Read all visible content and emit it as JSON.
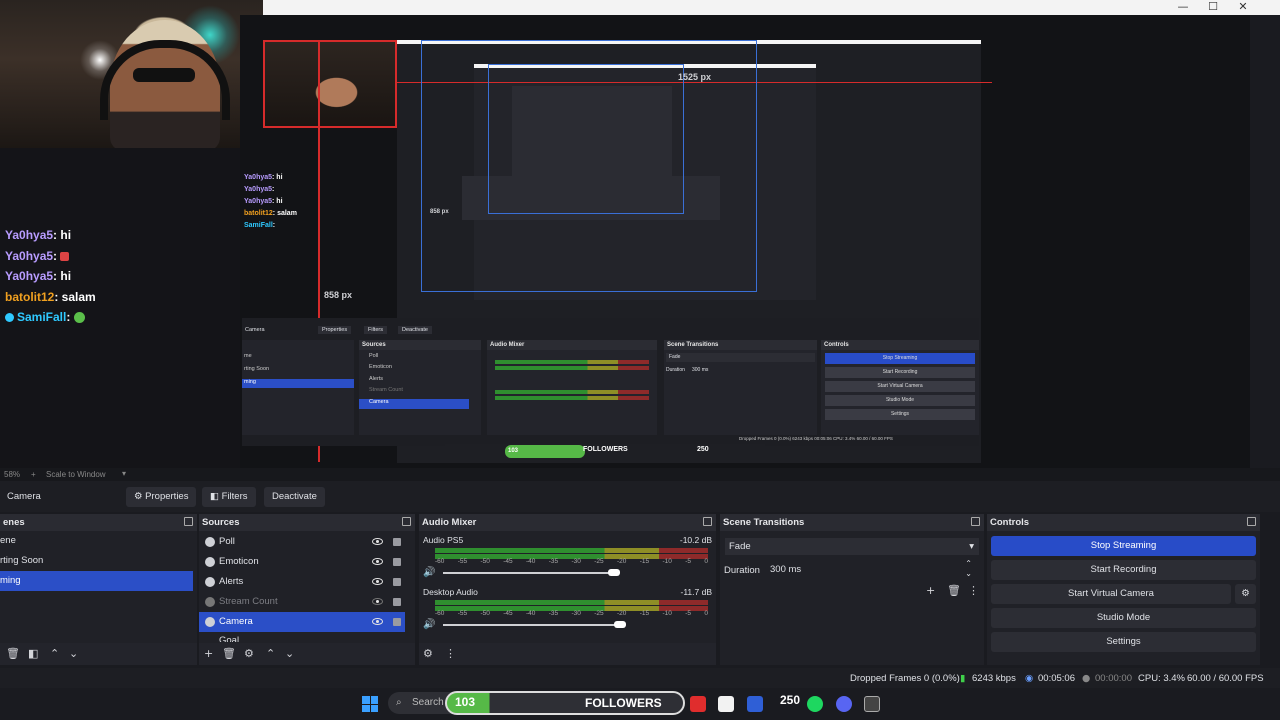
{
  "window": {
    "minimize": "—",
    "maximize": "☐",
    "close": "✕"
  },
  "chat": [
    {
      "user": "Ya0hya5",
      "msg": ": hi",
      "color": "#b89cff"
    },
    {
      "user": "Ya0hya5",
      "msg": ": ",
      "color": "#b89cff"
    },
    {
      "user": "Ya0hya5",
      "msg": ": hi",
      "color": "#b89cff"
    },
    {
      "user": "batolit12",
      "msg": ": salam",
      "color": "#f0a020"
    },
    {
      "user": "SamiFall",
      "msg": ": ",
      "color": "#2fc9ff"
    }
  ],
  "preview": {
    "width_label": "1525 px",
    "height_label": "858 px",
    "height_label_small": "858 px"
  },
  "mini": {
    "toolbar": {
      "camera": "Camera",
      "properties": "Properties",
      "filters": "Filters",
      "deactivate": "Deactivate"
    },
    "scenes": [
      "me",
      "rting Soon",
      "ming"
    ],
    "sources": [
      "Poll",
      "Emoticon",
      "Alerts",
      "Stream Count",
      "Camera"
    ],
    "mixer_title": "Audio Mixer",
    "transitions_title": "Scene Transitions",
    "controls_title": "Controls",
    "fade": "Fade",
    "duration": "Duration",
    "duration_val": "300 ms",
    "controls": [
      "Stop Streaming",
      "Start Recording",
      "Start Virtual Camera",
      "Studio Mode",
      "Settings"
    ],
    "status": "Dropped Frames 0 (0.0%)   6243 kbps   00:05:06   CPU: 3.4%   60.00 / 60.00 FPS",
    "followers": "FOLLOWERS",
    "follow_num": "103",
    "follow_count": "250"
  },
  "zoom": {
    "percent": "58%",
    "scale": "Scale to Window"
  },
  "source_toolbar": {
    "selected": "Camera",
    "properties": "Properties",
    "filters": "Filters",
    "deactivate": "Deactivate"
  },
  "scenes": {
    "title": "enes",
    "items": [
      {
        "label": "ene",
        "selected": false
      },
      {
        "label": "rting Soon",
        "selected": false
      },
      {
        "label": "ming",
        "selected": true
      }
    ]
  },
  "sources": {
    "title": "Sources",
    "items": [
      {
        "label": "Poll",
        "selected": false,
        "hidden": false
      },
      {
        "label": "Emoticon",
        "selected": false,
        "hidden": false
      },
      {
        "label": "Alerts",
        "selected": false,
        "hidden": false
      },
      {
        "label": "Stream Count",
        "selected": false,
        "hidden": true
      },
      {
        "label": "Camera",
        "selected": true,
        "hidden": false
      },
      {
        "label": "Goal",
        "selected": false,
        "hidden": false
      }
    ]
  },
  "mixer": {
    "title": "Audio Mixer",
    "scale": [
      "-60",
      "-55",
      "-50",
      "-45",
      "-40",
      "-35",
      "-30",
      "-25",
      "-20",
      "-15",
      "-10",
      "-5",
      "0"
    ],
    "channels": [
      {
        "name": "Audio PS5",
        "db": "-10.2 dB",
        "volume": 0.9
      },
      {
        "name": "Desktop Audio",
        "db": "-11.7 dB",
        "volume": 0.93
      }
    ]
  },
  "transitions": {
    "title": "Scene Transitions",
    "selected": "Fade",
    "duration_label": "Duration",
    "duration_value": "300 ms"
  },
  "controls": {
    "title": "Controls",
    "stop_streaming": "Stop Streaming",
    "start_recording": "Start Recording",
    "start_virtual_camera": "Start Virtual Camera",
    "studio_mode": "Studio Mode",
    "settings": "Settings"
  },
  "status": {
    "dropped": "Dropped Frames 0 (0.0%)",
    "kbps": "6243 kbps",
    "stream_time": "00:05:06",
    "rec_time": "00:00:00",
    "cpu": "CPU: 3.4%",
    "fps": "60.00 / 60.00 FPS"
  },
  "taskbar": {
    "search": "Search",
    "follow_num": "103",
    "followers": "FOLLOWERS",
    "count": "250"
  },
  "colors": {
    "accent": "#2b4fc7",
    "guide_red": "#d62b2b",
    "guide_blue": "#3a6fd6",
    "meter_green": "#2f8f2f"
  }
}
